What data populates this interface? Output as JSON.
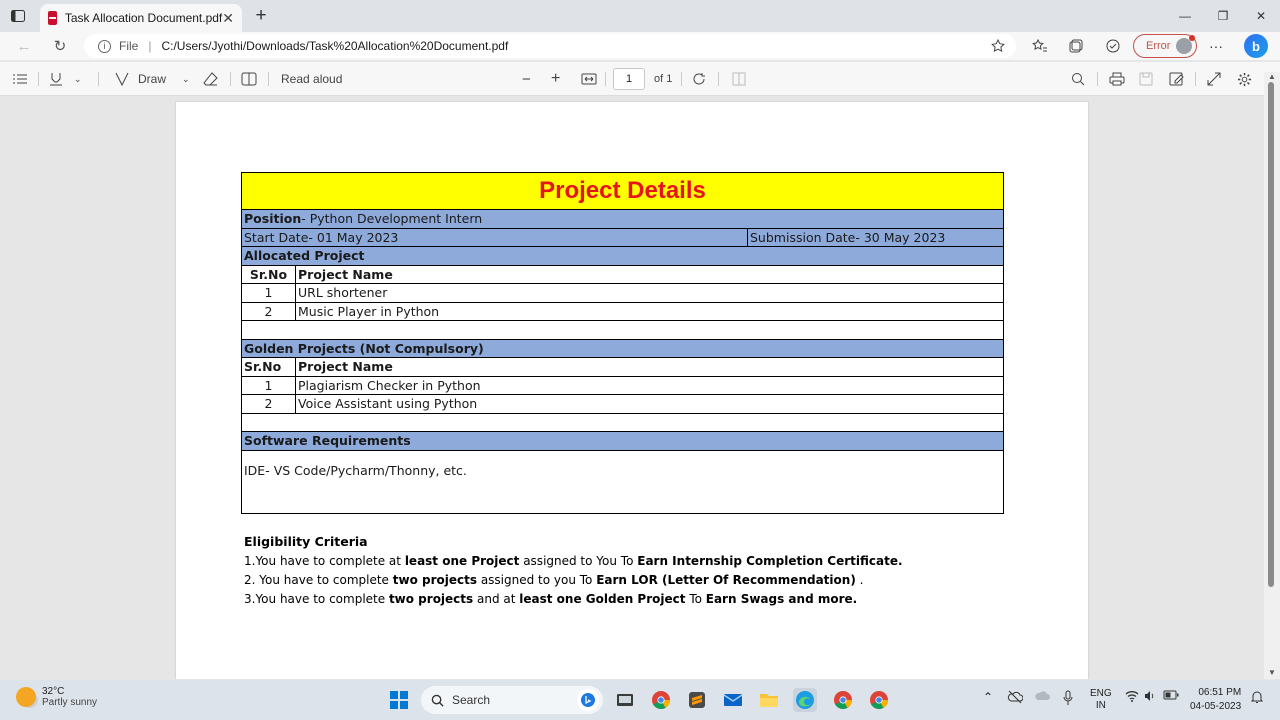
{
  "browser": {
    "tab": {
      "title": "Task Allocation Document.pdf",
      "icon": "pdf-icon"
    },
    "address": {
      "scheme": "File",
      "url": "C:/Users/Jyothi/Downloads/Task%20Allocation%20Document.pdf"
    },
    "profile": {
      "status": "Error"
    },
    "bing_label": "b"
  },
  "pdf_toolbar": {
    "draw_label": "Draw",
    "read_aloud_label": "Read aloud",
    "page_current": "1",
    "page_total": "of 1"
  },
  "document": {
    "title": "Project Details",
    "position_label": "Position",
    "position_value": "- Python Development Intern",
    "start_date": "Start Date- 01 May 2023",
    "submission_date": "Submission Date- 30 May 2023",
    "allocated_heading": "Allocated Project",
    "col_sr": "Sr.No",
    "col_name": "Project Name",
    "allocated_projects": [
      {
        "sr": "1",
        "name": "URL shortener"
      },
      {
        "sr": "2",
        "name": "Music Player in Python"
      }
    ],
    "golden_heading": "Golden Projects (Not Compulsory)",
    "golden_projects": [
      {
        "sr": "1",
        "name": "Plagiarism Checker in Python"
      },
      {
        "sr": "2",
        "name": "Voice Assistant using Python"
      }
    ],
    "software_heading": "Software Requirements",
    "software_body": "IDE- VS Code/Pycharm/Thonny, etc.",
    "eligibility": {
      "heading": "Eligibility Criteria",
      "l1a": "1.You have to complete at ",
      "l1b": "least one Project",
      "l1c": " assigned to You To ",
      "l1d": "Earn Internship Completion Certificate.",
      "l2a": "2. You have to complete ",
      "l2b": "two projects",
      "l2c": " assigned to you To ",
      "l2d": "Earn LOR (Letter Of Recommendation)",
      "l2e": " .",
      "l3a": "3.You have to complete ",
      "l3b": "two projects",
      "l3c": " and at ",
      "l3d": "least one Golden Project",
      "l3e": " To ",
      "l3f": "Earn Swags and more."
    }
  },
  "taskbar": {
    "weather_temp": "32°C",
    "weather_cond": "Partly sunny",
    "search_label": "Search",
    "lang_top": "ENG",
    "lang_bottom": "IN",
    "time": "06:51 PM",
    "date": "04-05-2023"
  }
}
